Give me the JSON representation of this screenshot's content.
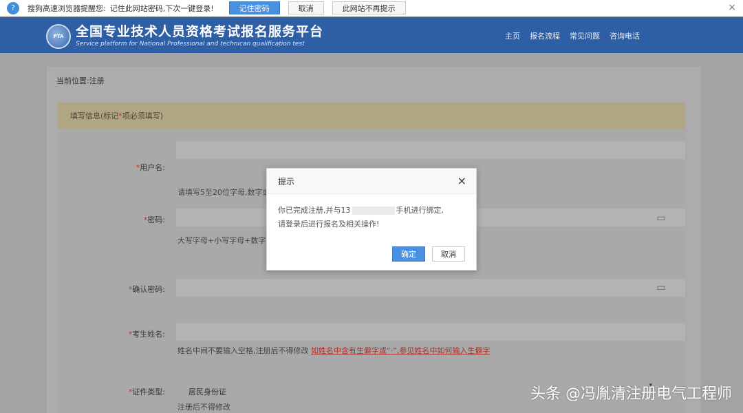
{
  "pwbar": {
    "message": "搜狗高速浏览器提醒您:",
    "message2": "记住此网站密码,下次一键登录!",
    "remember_label": "记住密码",
    "cancel_label": "取消",
    "never_label": "此网站不再提示",
    "close_glyph": "×",
    "key_glyph": "?"
  },
  "header": {
    "logo_text": "PTA",
    "title_cn": "全国专业技术人员资格考试报名服务平台",
    "title_en": "Service platform for National Professional and technican qualification test",
    "nav": [
      "主页",
      "报名流程",
      "常见问题",
      "咨询电话"
    ]
  },
  "breadcrumb": "当前位置:注册",
  "info_strip": {
    "prefix": "填写信息(标记",
    "star": "*",
    "suffix": "项必须填写)"
  },
  "form": {
    "username_label": "用户名:",
    "username_hint": "请填写5至20位字母,数字或",
    "password_label": "密码:",
    "password_hint": "大写字母+小写字母+数字的",
    "confirm_label": "确认密码:",
    "name_label": "考生姓名:",
    "name_hint": "姓名中间不要输入空格,注册后不得修改",
    "name_link": "如姓名中含有生僻字或“·”,参见姓名中如何输入生僻字",
    "idtype_label": "证件类型:",
    "idtype_value": "居民身份证",
    "idtype_hint": "注册后不得修改",
    "req_star": "*",
    "eye_glyph": "▭",
    "arrow_glyph": "▾"
  },
  "modal": {
    "title": "提示",
    "close_glyph": "×",
    "line1_prefix": "你已完成注册,并与13",
    "line1_suffix": "手机进行绑定,",
    "line2": "请登录后进行报名及相关操作!",
    "ok_label": "确定",
    "cancel_label": "取消"
  },
  "watermark": "头条 @冯胤清注册电气工程师"
}
